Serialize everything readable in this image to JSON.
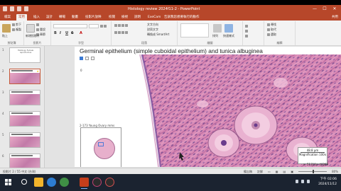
{
  "window": {
    "title": "Histology review 2024f11-2 - PowerPoint",
    "controls": [
      "—",
      "☐",
      "✕"
    ]
  },
  "ribbon_tabs": {
    "items": [
      "檔案",
      "常用",
      "插入",
      "設計",
      "轉場",
      "動畫",
      "投影片放映",
      "校閱",
      "檢視",
      "說明",
      "ExeCam",
      "告訴我您想要執行的動作"
    ],
    "active_index": 1,
    "share": "共用"
  },
  "ribbon": {
    "clipboard": {
      "label": "剪貼簿",
      "items": [
        "剪下",
        "複製",
        "貼上"
      ]
    },
    "slides": {
      "label": "投影片",
      "items": [
        "新增投影片",
        "重設",
        "章節"
      ]
    },
    "font": {
      "label": "字型",
      "font_name": "",
      "font_size": "",
      "buttons": [
        "B",
        "I",
        "U",
        "S",
        "A"
      ]
    },
    "paragraph": {
      "label": "段落",
      "items": [
        "文字方向",
        "對齊文字",
        "轉換成 SmartArt"
      ]
    },
    "drawing": {
      "label": "繪圖",
      "items": [
        "排列",
        "快速樣式"
      ]
    },
    "editing": {
      "label": "編輯",
      "items": [
        "尋找",
        "取代",
        "選取"
      ]
    }
  },
  "thumbnails": [
    {
      "num": "1",
      "type": "title",
      "caption": "Histology Female reproductive"
    },
    {
      "num": "2",
      "type": "histo",
      "selected": true
    },
    {
      "num": "3",
      "type": "histo"
    },
    {
      "num": "4",
      "type": "histo"
    },
    {
      "num": "5",
      "type": "histo"
    },
    {
      "num": "6",
      "type": "histo"
    },
    {
      "num": "7",
      "type": "histo"
    }
  ],
  "slide": {
    "title": "Germinal epithelium (simple cuboidal epithelium) and tunica albuginea",
    "star_icon": "★",
    "viewer_zoom": "0",
    "overview_label": "2-173 Young Ovary mms",
    "scale_label": "48.8 µm",
    "magnification": "Magnification 100x",
    "coords": "x: 51310y: 40289"
  },
  "statusbar": {
    "left": "投影片 2 / 55    中文 (台灣)",
    "notes": "備忘稿",
    "comments": "註解",
    "zoom": "80%"
  },
  "taskbar": {
    "time": "下午 02:06",
    "date": "2024/11/12"
  },
  "colors": {
    "accent": "#b7472a",
    "histology_pink": "#d98bb6",
    "taskbar": "#1b2330"
  }
}
